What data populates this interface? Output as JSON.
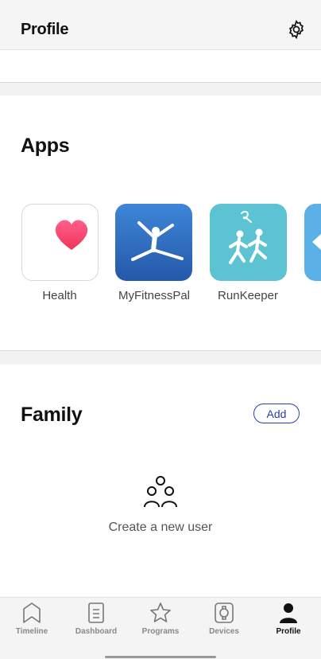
{
  "header": {
    "title": "Profile"
  },
  "apps": {
    "title": "Apps",
    "items": [
      {
        "label": "Health",
        "icon": "health-heart-icon"
      },
      {
        "label": "MyFitnessPal",
        "icon": "myfitnesspal-icon"
      },
      {
        "label": "RunKeeper",
        "icon": "runkeeper-icon"
      }
    ]
  },
  "family": {
    "title": "Family",
    "add_label": "Add",
    "empty_text": "Create a new user"
  },
  "tabs": [
    {
      "label": "Timeline",
      "icon": "timeline-icon"
    },
    {
      "label": "Dashboard",
      "icon": "dashboard-icon"
    },
    {
      "label": "Programs",
      "icon": "star-icon"
    },
    {
      "label": "Devices",
      "icon": "watch-icon"
    },
    {
      "label": "Profile",
      "icon": "person-icon",
      "active": true
    }
  ],
  "colors": {
    "accent": "#2a3ea6",
    "health_bg": "#ffffff",
    "mfp_bg": "#2f6fc0",
    "runkeeper_bg": "#5bc3d1"
  }
}
